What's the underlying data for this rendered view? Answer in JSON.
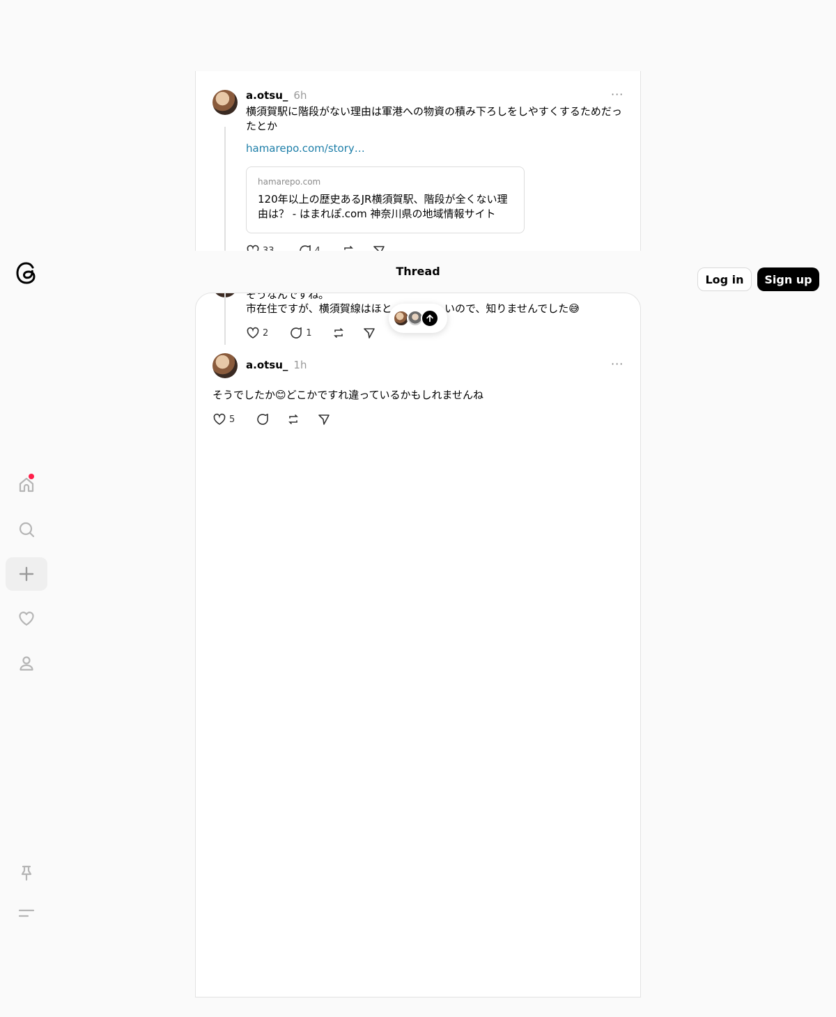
{
  "header": {
    "title": "Thread"
  },
  "auth": {
    "login_label": "Log in",
    "signup_label": "Sign up"
  },
  "nav": {
    "items": [
      {
        "name": "home",
        "icon": "home-icon",
        "has_notification": true
      },
      {
        "name": "search",
        "icon": "search-icon"
      },
      {
        "name": "create",
        "icon": "plus-icon",
        "active": true
      },
      {
        "name": "activity",
        "icon": "heart-icon"
      },
      {
        "name": "profile",
        "icon": "person-icon"
      }
    ],
    "bottom": [
      {
        "name": "pin",
        "icon": "pin-icon"
      },
      {
        "name": "menu",
        "icon": "menu-icon"
      }
    ]
  },
  "posts": {
    "first": {
      "username": "a.otsu_",
      "time": "6h",
      "more": "···",
      "text": "横須賀駅に階段がない理由は軍港への物資の積み下ろしをしやすくするためだったとか",
      "link": "hamarepo.com/story…",
      "link_card": {
        "domain": "hamarepo.com",
        "title": "120年以上の歴史あるJR横須賀駅、階段が全くない理由は？ - はまれぽ.com 神奈川県の地域情報サイト"
      },
      "likes": "33",
      "replies": "4"
    },
    "reply": {
      "text_line1": "そうなんですね。",
      "text_line2_left": "市在住ですが、横須賀線はほと",
      "text_line2_right": "いので、知りませんでした😅",
      "likes": "2",
      "replies": "1"
    },
    "second": {
      "username": "a.otsu_",
      "time": "1h",
      "more": "···",
      "text": "そうでしたか😊どこかですれ違っているかもしれませんね",
      "likes": "5"
    }
  },
  "colors": {
    "background": "#fafafa",
    "card": "#ffffff",
    "link": "#1d7ea8",
    "notification": "#ff1f4a",
    "signup_bg": "#000000"
  }
}
